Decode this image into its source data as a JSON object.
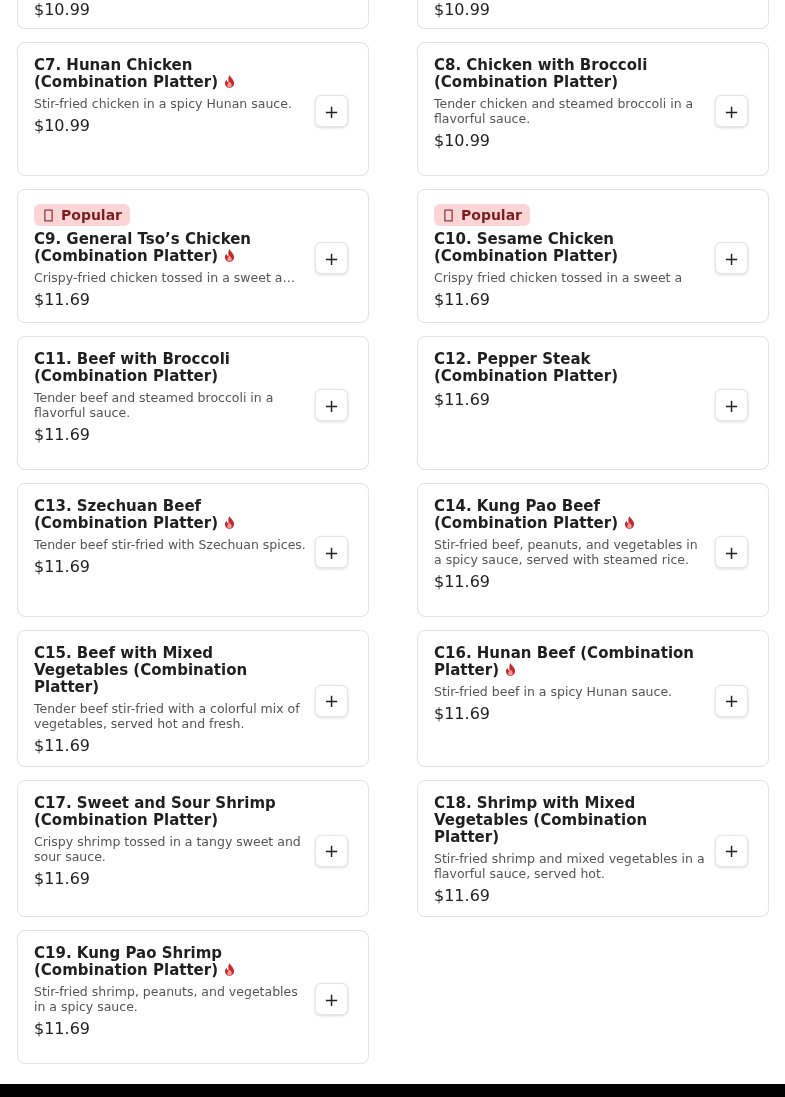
{
  "items": [
    {
      "kind": "partial",
      "price": "$10.99"
    },
    {
      "kind": "partial",
      "price": "$10.99"
    },
    {
      "kind": "full",
      "name": "C7. Hunan Chicken (Combination Platter)",
      "spicy": true,
      "description": "Stir-fried chicken in a spicy Hunan sauce.",
      "price": "$10.99",
      "add": "+"
    },
    {
      "kind": "full",
      "name": "C8. Chicken with Broccoli (Combination Platter)",
      "spicy": false,
      "description": "Tender chicken and steamed broccoli in a flavorful sauce.",
      "price": "$10.99",
      "add": "+"
    },
    {
      "kind": "full",
      "badge": "Popular",
      "name": "C9. General Tso’s Chicken (Combination Platter)",
      "spicy": true,
      "description": "Crispy-fried chicken tossed in a sweet a…",
      "price": "$11.69",
      "add": "+"
    },
    {
      "kind": "full",
      "badge": "Popular",
      "name": "C10. Sesame Chicken (Combination Platter)",
      "spicy": false,
      "description": "Crispy fried chicken tossed in a sweet a",
      "price": "$11.69",
      "add": "+"
    },
    {
      "kind": "full",
      "name": "C11. Beef with Broccoli (Combination Platter)",
      "spicy": false,
      "description": "Tender beef and steamed broccoli in a flavorful sauce.",
      "price": "$11.69",
      "add": "+"
    },
    {
      "kind": "full",
      "name": "C12. Pepper Steak (Combination Platter)",
      "spicy": false,
      "price": "$11.69",
      "add": "+"
    },
    {
      "kind": "full",
      "name": "C13. Szechuan Beef (Combination Platter)",
      "spicy": true,
      "description": "Tender beef stir-fried with Szechuan spices.",
      "price": "$11.69",
      "add": "+"
    },
    {
      "kind": "full",
      "name": "C14. Kung Pao Beef (Combination Platter)",
      "spicy": true,
      "description": "Stir-fried beef, peanuts, and vegetables in a spicy sauce, served with steamed rice.",
      "price": "$11.69",
      "add": "+"
    },
    {
      "kind": "full",
      "name": "C15. Beef with Mixed Vegetables (Combination Platter)",
      "spicy": false,
      "description": "Tender beef stir-fried with a colorful mix of vegetables, served hot and fresh.",
      "price": "$11.69",
      "add": "+"
    },
    {
      "kind": "full",
      "name": "C16. Hunan Beef (Combination Platter)",
      "spicy": true,
      "description": "Stir-fried beef in a spicy Hunan sauce.",
      "price": "$11.69",
      "add": "+"
    },
    {
      "kind": "full",
      "name": "C17. Sweet and Sour Shrimp (Combination Platter)",
      "spicy": false,
      "description": "Crispy shrimp tossed in a tangy sweet and sour sauce.",
      "price": "$11.69",
      "add": "+"
    },
    {
      "kind": "full",
      "name": "C18. Shrimp with Mixed Vegetables (Combination Platter)",
      "spicy": false,
      "description": "Stir-fried shrimp and mixed vegetables in a flavorful sauce, served hot.",
      "price": "$11.69",
      "add": "+"
    },
    {
      "kind": "full",
      "name": "C19. Kung Pao Shrimp (Combination Platter)",
      "spicy": true,
      "description": "Stir-fried shrimp, peanuts, and vegetables in a spicy sauce.",
      "price": "$11.69",
      "add": "+"
    }
  ]
}
